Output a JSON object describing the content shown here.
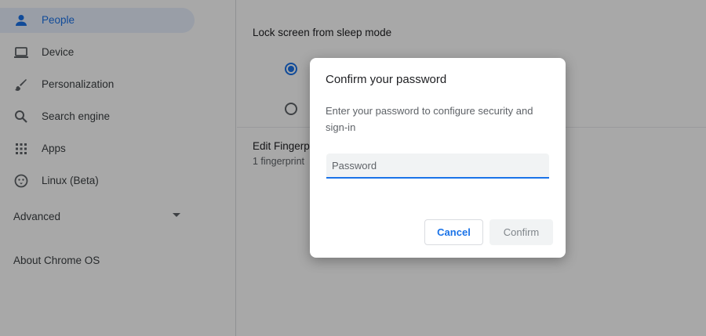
{
  "sidebar": {
    "items": [
      {
        "label": "People",
        "icon": "person-icon",
        "selected": true
      },
      {
        "label": "Device",
        "icon": "laptop-icon",
        "selected": false
      },
      {
        "label": "Personalization",
        "icon": "brush-icon",
        "selected": false
      },
      {
        "label": "Search engine",
        "icon": "search-icon",
        "selected": false
      },
      {
        "label": "Apps",
        "icon": "apps-grid-icon",
        "selected": false
      },
      {
        "label": "Linux (Beta)",
        "icon": "linux-penguin-icon",
        "selected": false
      }
    ],
    "advanced_label": "Advanced",
    "about_label": "About Chrome OS"
  },
  "main": {
    "lock_screen_title": "Lock screen from sleep mode",
    "fingerprint_title": "Edit Fingerpr",
    "fingerprint_sub": "1 fingerprint"
  },
  "dialog": {
    "title": "Confirm your password",
    "body": "Enter your password to configure security and sign-in",
    "password_placeholder": "Password",
    "cancel_label": "Cancel",
    "confirm_label": "Confirm"
  },
  "colors": {
    "accent": "#1a73e8",
    "selected_nav_bg": "#e8f0fe",
    "scrim": "rgba(0,0,0,0.34)"
  }
}
